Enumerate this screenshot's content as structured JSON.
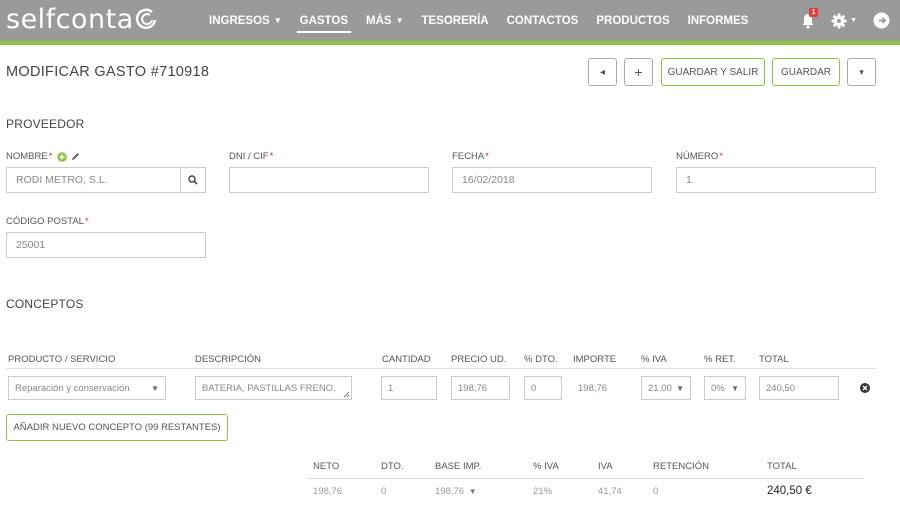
{
  "app": {
    "logo": "selfconta",
    "nav": [
      {
        "label": "INGRESOS",
        "dropdown": true
      },
      {
        "label": "GASTOS",
        "dropdown": false,
        "active": true
      },
      {
        "label": "MÁS",
        "dropdown": true
      },
      {
        "label": "TESORERÍA",
        "dropdown": false
      },
      {
        "label": "CONTACTOS",
        "dropdown": false
      },
      {
        "label": "PRODUCTOS",
        "dropdown": false
      },
      {
        "label": "INFORMES",
        "dropdown": false
      }
    ],
    "notification_count": "1",
    "icons": [
      "bell-icon",
      "gear-icon",
      "logout-icon"
    ]
  },
  "header": {
    "title": "MODIFICAR GASTO #710918",
    "buttons": {
      "prev": "◂",
      "add": "+",
      "save_exit": "GUARDAR Y SALIR",
      "save": "GUARDAR",
      "more": "▾"
    }
  },
  "proveedor": {
    "section_title": "PROVEEDOR",
    "nombre": {
      "label": "NOMBRE",
      "value": "RODI METRO, S.L."
    },
    "dni": {
      "label": "DNI / CIF",
      "value": ""
    },
    "fecha": {
      "label": "FECHA",
      "value": "16/02/2018"
    },
    "numero": {
      "label": "NÚMERO",
      "value": "1"
    },
    "codigo_postal": {
      "label": "CÓDIGO POSTAL",
      "value": "25001"
    }
  },
  "conceptos": {
    "section_title": "CONCEPTOS",
    "columns": [
      "PRODUCTO / SERVICIO",
      "DESCRIPCIÓN",
      "CANTIDAD",
      "PRECIO UD.",
      "% DTO.",
      "IMPORTE",
      "% IVA",
      "% RET.",
      "TOTAL"
    ],
    "rows": [
      {
        "producto": "Reparación y conservación",
        "descripcion": "BATERIA, PASTILLAS FRENO,",
        "cantidad": "1",
        "precio": "198,76",
        "dto": "0",
        "importe": "198,76",
        "iva": "21,00",
        "ret": "0%",
        "total": "240,50"
      }
    ],
    "add_button": "AÑADIR NUEVO CONCEPTO (99 RESTANTES)"
  },
  "totals": {
    "headers": [
      "NETO",
      "DTO.",
      "BASE IMP.",
      "% IVA",
      "IVA",
      "RETENCIÓN",
      "TOTAL"
    ],
    "values": [
      "198,76",
      "0",
      "198,76",
      "21%",
      "41,74",
      "0",
      "240,50 €"
    ]
  },
  "colors": {
    "topbar": "#9a9a9a",
    "accent": "#8dc63f",
    "required": "#c0392b",
    "badge": "#e53935"
  }
}
